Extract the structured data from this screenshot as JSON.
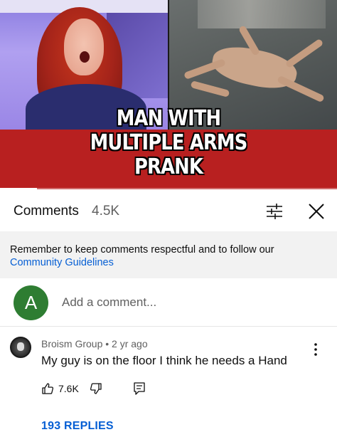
{
  "video": {
    "title_lines": [
      "MAN WITH",
      "MULTIPLE ARMS",
      "PRANK"
    ],
    "progress_fraction": 0.11
  },
  "comments_panel": {
    "title": "Comments",
    "count": "4.5K",
    "filter_icon": "sliders-icon",
    "close_icon": "close-icon"
  },
  "notice": {
    "text": "Remember to keep comments respectful and to follow our",
    "link": "Community Guidelines"
  },
  "add_comment": {
    "avatar_letter": "A",
    "avatar_color": "#2e7d32",
    "placeholder": "Add a comment..."
  },
  "comments": [
    {
      "author": "Broism Group",
      "separator": "•",
      "time": "2 yr ago",
      "text": "My guy is on the floor I think he needs a Hand",
      "likes": "7.6K",
      "replies": "193 REPLIES"
    }
  ],
  "colors": {
    "link_blue": "#065fd4",
    "title_band_red": "#b82020",
    "notice_bg": "#f2f2f2"
  }
}
